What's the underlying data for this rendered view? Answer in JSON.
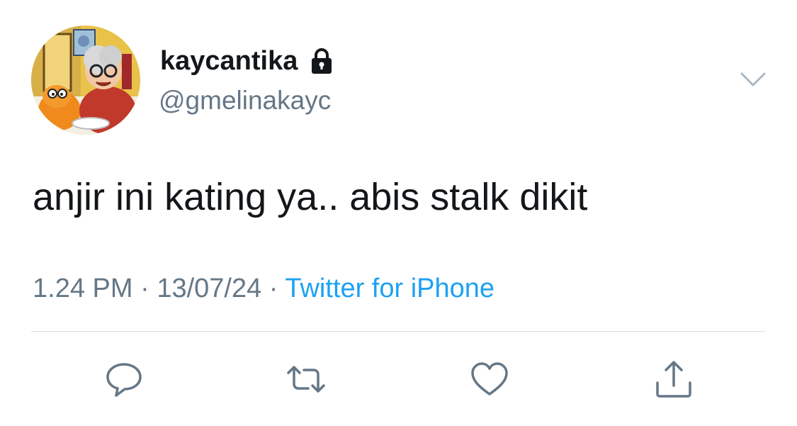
{
  "user": {
    "display_name": "kaycantika",
    "handle": "@gmelinakayc",
    "protected_icon": "lock-icon",
    "avatar_icon": "avatar-image"
  },
  "tweet": {
    "text": "anjir ini kating ya.. abis stalk dikit"
  },
  "meta": {
    "time": "1.24 PM",
    "separator1": " · ",
    "date": "13/07/24",
    "separator2": " · ",
    "source": "Twitter for iPhone"
  },
  "actions": {
    "reply_icon": "reply-icon",
    "retweet_icon": "retweet-icon",
    "like_icon": "heart-icon",
    "share_icon": "share-icon",
    "more_icon": "chevron-down-icon"
  },
  "colors": {
    "text_primary": "#14171a",
    "text_secondary": "#657786",
    "link_blue": "#1da1f2",
    "divider": "#d8dde1"
  }
}
